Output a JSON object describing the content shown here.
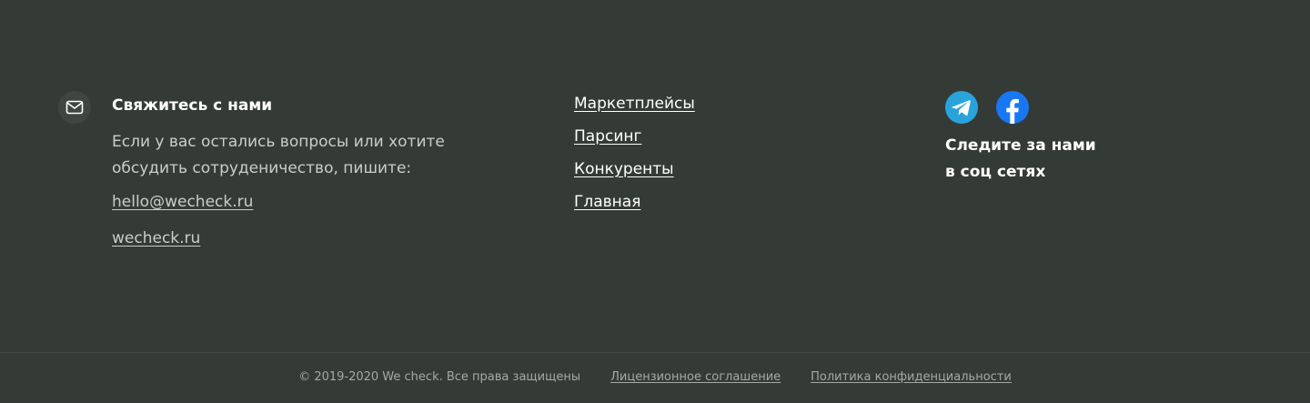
{
  "contact": {
    "icon": "mail-icon",
    "title": "Свяжитесь с нами",
    "text": "Если у вас остались вопросы или хотите обсудить сотруденичество, пишите:",
    "email": "hello@wecheck.ru",
    "site": "wecheck.ru"
  },
  "nav": {
    "items": [
      {
        "label": "Маркетплейсы"
      },
      {
        "label": "Парсинг "
      },
      {
        "label": "Конкуренты"
      },
      {
        "label": "Главная"
      }
    ]
  },
  "social": {
    "icons": [
      "telegram-icon",
      "facebook-icon"
    ],
    "caption_line1": "Следите за нами",
    "caption_line2": "в соц сетях"
  },
  "bottom": {
    "copyright": "© 2019-2020 We check. Все права защищены",
    "license": "Лицензионное соглашение",
    "privacy": "Политика конфиденциальности"
  },
  "colors": {
    "background": "#343b37",
    "telegram": "#2aa3db",
    "facebook": "#1877f2"
  }
}
